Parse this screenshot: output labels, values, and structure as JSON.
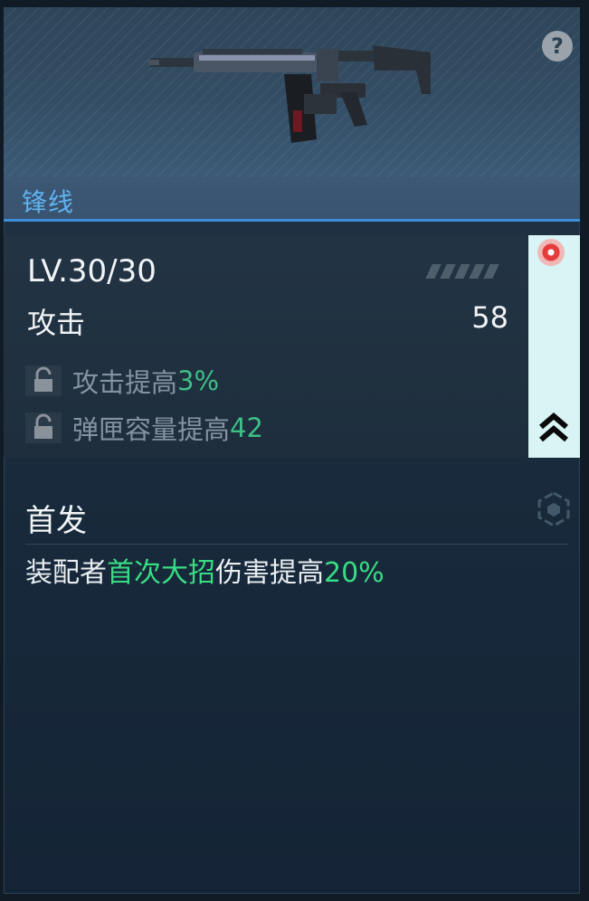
{
  "header": {
    "help_icon": "question-mark-icon",
    "help_label": "?",
    "weapon_image": "assault-rifle-image",
    "weapon_name": "锋线"
  },
  "stats": {
    "level": "LV.30/30",
    "attack_label": "攻击",
    "attack_value": "58",
    "perks": [
      {
        "text": "攻击提高",
        "value": "3%",
        "locked": true
      },
      {
        "text": "弹匣容量提高",
        "value": "42",
        "locked": true
      }
    ],
    "upgrade_icon": "double-chevron-up-icon",
    "notification_icon": "red-dot-icon"
  },
  "special": {
    "title": "首发",
    "icon": "hexagon-icon",
    "desc_prefix": "装配者",
    "desc_highlight1": "首次大招",
    "desc_middle": "伤害提高",
    "desc_highlight2": "20%"
  },
  "colors": {
    "name_blue": "#5fb2f0",
    "perk_green": "#3fbf86",
    "desc_green": "#39dc84",
    "accent_line": "#3d8fd8"
  }
}
